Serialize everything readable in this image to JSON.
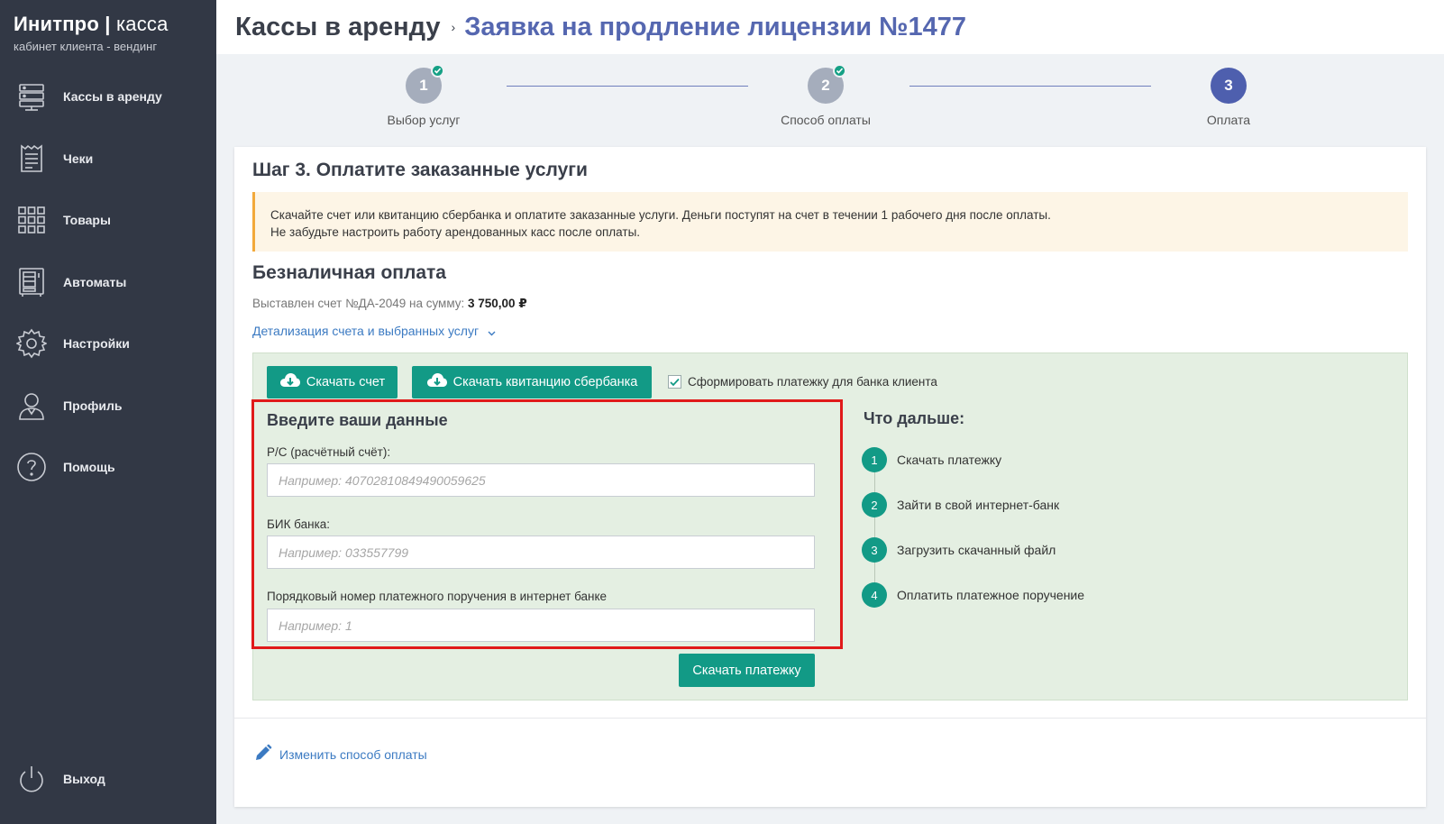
{
  "brand": {
    "title_bold": "Инитпро |",
    "title_thin": " касса",
    "subtitle": "кабинет клиента - вендинг"
  },
  "nav": [
    {
      "label": "Кассы в аренду",
      "icon": "server-icon"
    },
    {
      "label": "Чеки",
      "icon": "receipt-icon"
    },
    {
      "label": "Товары",
      "icon": "grid-icon"
    },
    {
      "label": "Автоматы",
      "icon": "vending-machine-icon"
    },
    {
      "label": "Настройки",
      "icon": "gear-icon"
    },
    {
      "label": "Профиль",
      "icon": "user-icon"
    },
    {
      "label": "Помощь",
      "icon": "help-icon"
    }
  ],
  "logout": {
    "label": "Выход",
    "icon": "power-icon"
  },
  "header": {
    "root": "Кассы в аренду",
    "separator": "›",
    "current": "Заявка на продление лицензии №1477"
  },
  "stepper": [
    {
      "number": "1",
      "label": "Выбор услуг",
      "state": "done"
    },
    {
      "number": "2",
      "label": "Способ оплаты",
      "state": "done"
    },
    {
      "number": "3",
      "label": "Оплата",
      "state": "active"
    }
  ],
  "main": {
    "title": "Шаг 3. Оплатите заказанные услуги",
    "notice_line1": "Скачайте счет или квитанцию сбербанка и оплатите заказанные услуги. Деньги поступят на счет в течении 1 рабочего дня после оплаты.",
    "notice_line2": "Не забудьте настроить работу арендованных касс после оплаты.",
    "section_title": "Безналичная оплата",
    "invoice_text": "Выставлен счет №ДА-2049 на сумму: ",
    "invoice_amount": "3 750,00 ₽",
    "details_link": "Детализация счета и выбранных услуг",
    "download_invoice": "Скачать счет",
    "download_receipt": "Скачать квитанцию сбербанка",
    "checkbox_label": "Сформировать платежку для банка клиента",
    "checkbox_checked": true,
    "form_title": "Введите ваши данные",
    "field_account_label": "Р/С (расчётный счёт):",
    "field_account_placeholder": "Например: 40702810849490059625",
    "field_bik_label": "БИК банка:",
    "field_bik_placeholder": "Например: 033557799",
    "field_order_label": "Порядковый номер платежного поручения в интернет банке",
    "field_order_placeholder": "Например: 1",
    "download_payment_button": "Скачать платежку",
    "next_title": "Что дальше:",
    "next_steps": [
      {
        "number": "1",
        "text": "Скачать платежку"
      },
      {
        "number": "2",
        "text": "Зайти в свой интернет-банк"
      },
      {
        "number": "3",
        "text": "Загрузить скачанный файл"
      },
      {
        "number": "4",
        "text": "Оплатить платежное поручение"
      }
    ],
    "change_payment_link": "Изменить способ оплаты"
  },
  "colors": {
    "sidebar": "#323845",
    "accent": "#4e5fae",
    "teal": "#129a86",
    "highlight": "#e01a1a"
  }
}
